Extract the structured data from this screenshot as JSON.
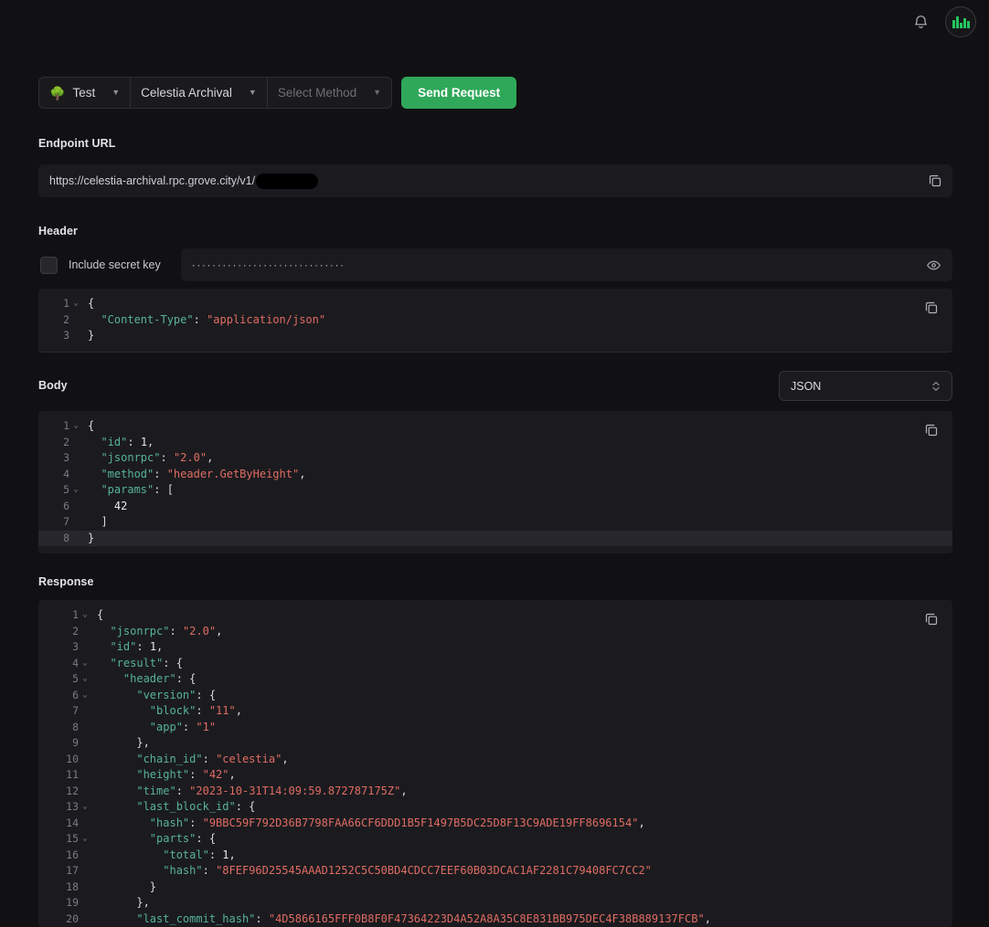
{
  "topbar": {
    "notification_icon": "bell-icon",
    "avatar_logo": "grove-logo"
  },
  "request_bar": {
    "environment": {
      "emoji": "🌳",
      "label": "Test"
    },
    "chain": {
      "label": "Celestia Archival"
    },
    "method": {
      "placeholder": "Select Method"
    },
    "send_label": "Send Request",
    "send_color": "#2fa85a"
  },
  "endpoint": {
    "label": "Endpoint URL",
    "url": "https://celestia-archival.rpc.grove.city/v1/",
    "redacted": true,
    "copy_icon": "copy-icon"
  },
  "header_section": {
    "label": "Header",
    "checkbox_label": "Include secret key",
    "checkbox_checked": false,
    "secret_value": "······························",
    "reveal_icon": "eye-icon",
    "copy_icon": "copy-icon",
    "lines": [
      {
        "n": "1",
        "fold": "⌄",
        "tokens": [
          {
            "t": "{",
            "c": "p"
          }
        ],
        "indent": 0
      },
      {
        "n": "2",
        "fold": "",
        "tokens": [
          {
            "t": "\"Content-Type\"",
            "c": "k"
          },
          {
            "t": ": ",
            "c": "p"
          },
          {
            "t": "\"application/json\"",
            "c": "s"
          }
        ],
        "indent": 1
      },
      {
        "n": "3",
        "fold": "",
        "tokens": [
          {
            "t": "}",
            "c": "p"
          }
        ],
        "indent": 0
      }
    ]
  },
  "body_section": {
    "label": "Body",
    "format": "JSON",
    "copy_icon": "copy-icon",
    "lines": [
      {
        "n": "1",
        "fold": "⌄",
        "tokens": [
          {
            "t": "{",
            "c": "p"
          }
        ],
        "indent": 0,
        "hl": false
      },
      {
        "n": "2",
        "fold": "",
        "tokens": [
          {
            "t": "\"id\"",
            "c": "k"
          },
          {
            "t": ": ",
            "c": "p"
          },
          {
            "t": "1",
            "c": "n"
          },
          {
            "t": ",",
            "c": "p"
          }
        ],
        "indent": 1,
        "hl": false
      },
      {
        "n": "3",
        "fold": "",
        "tokens": [
          {
            "t": "\"jsonrpc\"",
            "c": "k"
          },
          {
            "t": ": ",
            "c": "p"
          },
          {
            "t": "\"2.0\"",
            "c": "s"
          },
          {
            "t": ",",
            "c": "p"
          }
        ],
        "indent": 1,
        "hl": false
      },
      {
        "n": "4",
        "fold": "",
        "tokens": [
          {
            "t": "\"method\"",
            "c": "k"
          },
          {
            "t": ": ",
            "c": "p"
          },
          {
            "t": "\"header.GetByHeight\"",
            "c": "s"
          },
          {
            "t": ",",
            "c": "p"
          }
        ],
        "indent": 1,
        "hl": false
      },
      {
        "n": "5",
        "fold": "⌄",
        "tokens": [
          {
            "t": "\"params\"",
            "c": "k"
          },
          {
            "t": ": [",
            "c": "p"
          }
        ],
        "indent": 1,
        "hl": false
      },
      {
        "n": "6",
        "fold": "",
        "tokens": [
          {
            "t": "42",
            "c": "n"
          }
        ],
        "indent": 2,
        "hl": false
      },
      {
        "n": "7",
        "fold": "",
        "tokens": [
          {
            "t": "]",
            "c": "p"
          }
        ],
        "indent": 1,
        "hl": false
      },
      {
        "n": "8",
        "fold": "",
        "tokens": [
          {
            "t": "}",
            "c": "p"
          }
        ],
        "indent": 0,
        "hl": true
      }
    ]
  },
  "response_section": {
    "label": "Response",
    "copy_icon": "copy-icon",
    "lines": [
      {
        "n": "1",
        "fold": "⌄",
        "tokens": [
          {
            "t": "{",
            "c": "p"
          }
        ],
        "indent": 0
      },
      {
        "n": "2",
        "fold": "",
        "tokens": [
          {
            "t": "\"jsonrpc\"",
            "c": "k"
          },
          {
            "t": ": ",
            "c": "p"
          },
          {
            "t": "\"2.0\"",
            "c": "s"
          },
          {
            "t": ",",
            "c": "p"
          }
        ],
        "indent": 1
      },
      {
        "n": "3",
        "fold": "",
        "tokens": [
          {
            "t": "\"id\"",
            "c": "k"
          },
          {
            "t": ": ",
            "c": "p"
          },
          {
            "t": "1",
            "c": "n"
          },
          {
            "t": ",",
            "c": "p"
          }
        ],
        "indent": 1
      },
      {
        "n": "4",
        "fold": "⌄",
        "tokens": [
          {
            "t": "\"result\"",
            "c": "k"
          },
          {
            "t": ": {",
            "c": "p"
          }
        ],
        "indent": 1
      },
      {
        "n": "5",
        "fold": "⌄",
        "tokens": [
          {
            "t": "\"header\"",
            "c": "k"
          },
          {
            "t": ": {",
            "c": "p"
          }
        ],
        "indent": 2
      },
      {
        "n": "6",
        "fold": "⌄",
        "tokens": [
          {
            "t": "\"version\"",
            "c": "k"
          },
          {
            "t": ": {",
            "c": "p"
          }
        ],
        "indent": 3
      },
      {
        "n": "7",
        "fold": "",
        "tokens": [
          {
            "t": "\"block\"",
            "c": "k"
          },
          {
            "t": ": ",
            "c": "p"
          },
          {
            "t": "\"11\"",
            "c": "s"
          },
          {
            "t": ",",
            "c": "p"
          }
        ],
        "indent": 4
      },
      {
        "n": "8",
        "fold": "",
        "tokens": [
          {
            "t": "\"app\"",
            "c": "k"
          },
          {
            "t": ": ",
            "c": "p"
          },
          {
            "t": "\"1\"",
            "c": "s"
          }
        ],
        "indent": 4
      },
      {
        "n": "9",
        "fold": "",
        "tokens": [
          {
            "t": "},",
            "c": "p"
          }
        ],
        "indent": 3
      },
      {
        "n": "10",
        "fold": "",
        "tokens": [
          {
            "t": "\"chain_id\"",
            "c": "k"
          },
          {
            "t": ": ",
            "c": "p"
          },
          {
            "t": "\"celestia\"",
            "c": "s"
          },
          {
            "t": ",",
            "c": "p"
          }
        ],
        "indent": 3
      },
      {
        "n": "11",
        "fold": "",
        "tokens": [
          {
            "t": "\"height\"",
            "c": "k"
          },
          {
            "t": ": ",
            "c": "p"
          },
          {
            "t": "\"42\"",
            "c": "s"
          },
          {
            "t": ",",
            "c": "p"
          }
        ],
        "indent": 3
      },
      {
        "n": "12",
        "fold": "",
        "tokens": [
          {
            "t": "\"time\"",
            "c": "k"
          },
          {
            "t": ": ",
            "c": "p"
          },
          {
            "t": "\"2023-10-31T14:09:59.872787175Z\"",
            "c": "s"
          },
          {
            "t": ",",
            "c": "p"
          }
        ],
        "indent": 3
      },
      {
        "n": "13",
        "fold": "⌄",
        "tokens": [
          {
            "t": "\"last_block_id\"",
            "c": "k"
          },
          {
            "t": ": {",
            "c": "p"
          }
        ],
        "indent": 3
      },
      {
        "n": "14",
        "fold": "",
        "tokens": [
          {
            "t": "\"hash\"",
            "c": "k"
          },
          {
            "t": ": ",
            "c": "p"
          },
          {
            "t": "\"9BBC59F792D36B7798FAA66CF6DDD1B5F1497B5DC25D8F13C9ADE19FF8696154\"",
            "c": "s"
          },
          {
            "t": ",",
            "c": "p"
          }
        ],
        "indent": 4
      },
      {
        "n": "15",
        "fold": "⌄",
        "tokens": [
          {
            "t": "\"parts\"",
            "c": "k"
          },
          {
            "t": ": {",
            "c": "p"
          }
        ],
        "indent": 4
      },
      {
        "n": "16",
        "fold": "",
        "tokens": [
          {
            "t": "\"total\"",
            "c": "k"
          },
          {
            "t": ": ",
            "c": "p"
          },
          {
            "t": "1",
            "c": "n"
          },
          {
            "t": ",",
            "c": "p"
          }
        ],
        "indent": 5
      },
      {
        "n": "17",
        "fold": "",
        "tokens": [
          {
            "t": "\"hash\"",
            "c": "k"
          },
          {
            "t": ": ",
            "c": "p"
          },
          {
            "t": "\"8FEF96D25545AAAD1252C5C50BD4CDCC7EEF60B03DCAC1AF2281C79408FC7CC2\"",
            "c": "s"
          }
        ],
        "indent": 5
      },
      {
        "n": "18",
        "fold": "",
        "tokens": [
          {
            "t": "}",
            "c": "p"
          }
        ],
        "indent": 4
      },
      {
        "n": "19",
        "fold": "",
        "tokens": [
          {
            "t": "},",
            "c": "p"
          }
        ],
        "indent": 3
      },
      {
        "n": "20",
        "fold": "",
        "tokens": [
          {
            "t": "\"last_commit_hash\"",
            "c": "k"
          },
          {
            "t": ": ",
            "c": "p"
          },
          {
            "t": "\"4D5866165FFF0B8F0F47364223D4A52A8A35C8E831BB975DEC4F38B889137FCB\"",
            "c": "s"
          },
          {
            "t": ",",
            "c": "p"
          }
        ],
        "indent": 3
      }
    ]
  }
}
